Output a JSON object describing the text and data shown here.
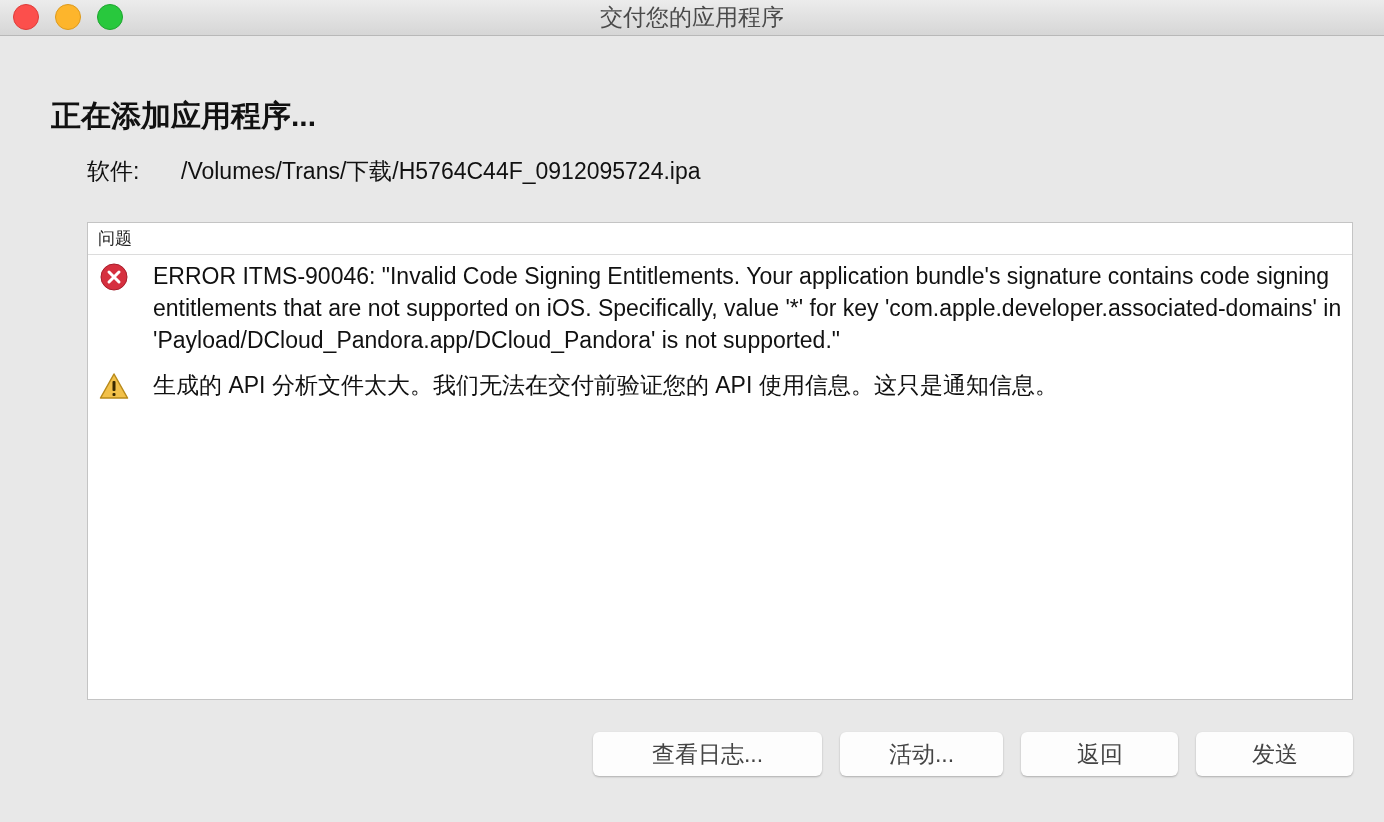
{
  "window": {
    "title": "交付您的应用程序"
  },
  "heading": "正在添加应用程序...",
  "software": {
    "label": "软件:",
    "path": "/Volumes/Trans/下载/H5764C44F_0912095724.ipa"
  },
  "issues": {
    "header": "问题",
    "items": [
      {
        "kind": "error",
        "text": "ERROR ITMS-90046: \"Invalid Code Signing Entitlements. Your application bundle's signature contains code signing entitlements that are not supported on iOS. Specifically, value '*' for key 'com.apple.developer.associated-domains' in 'Payload/DCloud_Pandora.app/DCloud_Pandora' is not supported.\""
      },
      {
        "kind": "warning",
        "text": "生成的 API 分析文件太大。我们无法在交付前验证您的 API 使用信息。这只是通知信息。"
      }
    ]
  },
  "buttons": [
    "查看日志...",
    "活动...",
    "返回",
    "发送"
  ]
}
